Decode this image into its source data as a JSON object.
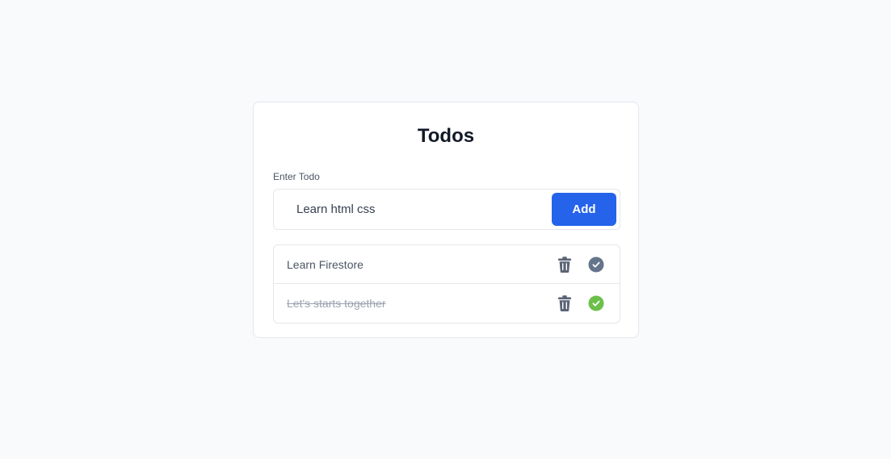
{
  "header": {
    "title": "Todos"
  },
  "form": {
    "label": "Enter Todo",
    "input_value": "Learn html css",
    "add_label": "Add"
  },
  "todos": [
    {
      "text": "Learn Firestore",
      "completed": false,
      "delete_icon": "trash-icon",
      "status_icon": "check-circle-icon"
    },
    {
      "text": "Let's starts together",
      "completed": true,
      "delete_icon": "trash-icon",
      "status_icon": "check-circle-icon"
    }
  ],
  "colors": {
    "accent": "#2563eb",
    "completed_check": "#6cc04a",
    "pending_check": "#64748b",
    "icon": "#5b6475"
  }
}
